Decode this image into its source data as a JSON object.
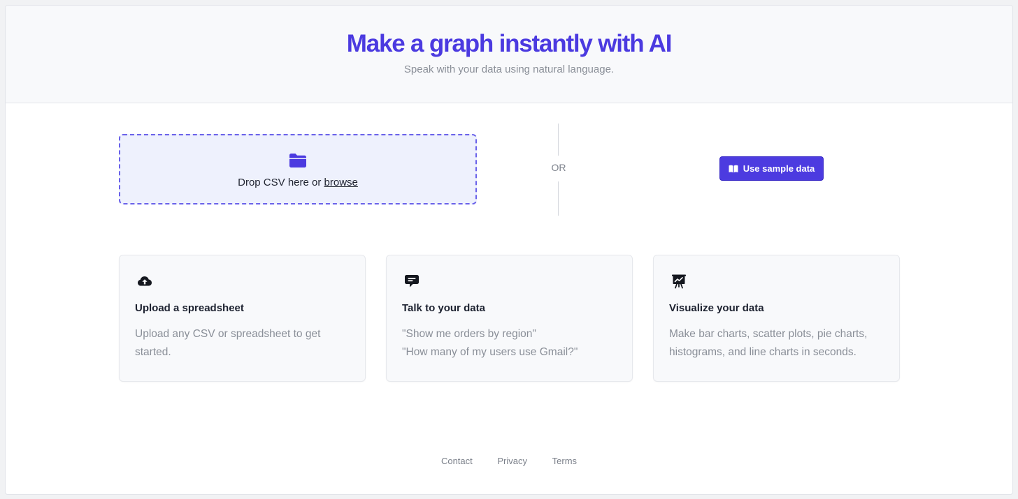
{
  "hero": {
    "title": "Make a graph instantly with AI",
    "subtitle": "Speak with your data using natural language."
  },
  "upload": {
    "drop_text": "Drop CSV here or ",
    "browse_link": "browse",
    "icon": "folder-icon"
  },
  "divider": {
    "or_label": "OR"
  },
  "sample": {
    "button_label": "Use sample data",
    "icon": "book-icon"
  },
  "features": [
    {
      "icon": "cloud-upload-icon",
      "title": "Upload a spreadsheet",
      "lines": [
        "Upload any CSV or spreadsheet to get",
        "started."
      ]
    },
    {
      "icon": "chat-bubble-icon",
      "title": "Talk to your data",
      "lines": [
        "\"Show me orders by region\"",
        "\"How many of my users use Gmail?\""
      ]
    },
    {
      "icon": "presentation-chart-icon",
      "title": "Visualize your data",
      "lines": [
        "Make bar charts, scatter plots, pie charts,",
        "histograms, and line charts in seconds."
      ]
    }
  ],
  "footer": {
    "links": [
      "Contact",
      "Privacy",
      "Terms"
    ]
  },
  "colors": {
    "accent": "#4b3ae0",
    "dropzone_bg": "#eef1fd",
    "dropzone_border": "#6a62ea",
    "muted_text": "#8a8f98"
  }
}
